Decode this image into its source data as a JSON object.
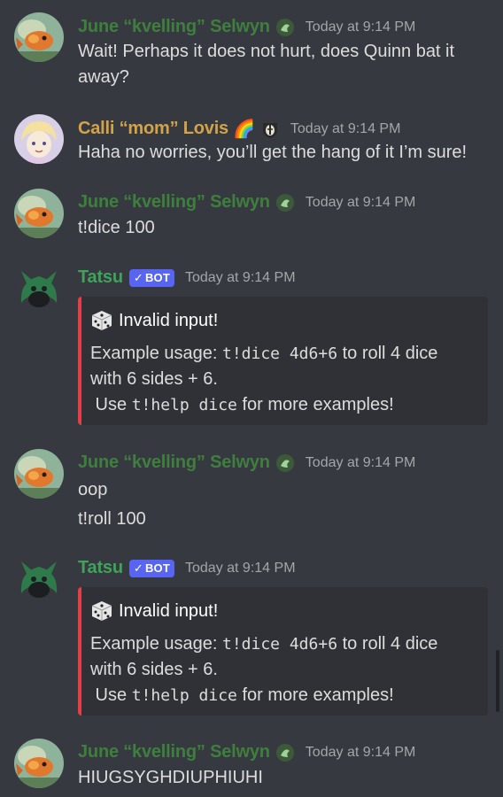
{
  "colors": {
    "background": "#36393f",
    "june_name": "#3f7f3e",
    "calli_name": "#d3a34a",
    "tatsu_name": "#3fa35b",
    "bot_tag": "#5865f2",
    "embed_border": "#e0404a",
    "embed_bg": "#2f3136",
    "timestamp": "#a3a6aa"
  },
  "messages": [
    {
      "author": "June “kvelling” Selwyn",
      "timestamp": "Today at 9:14 PM",
      "avatar_icon": "goldfish-avatar-icon",
      "role_icon": "green-badge-icon",
      "lines": [
        "Wait! Perhaps it does not hurt, does Quinn bat it",
        "away?"
      ]
    },
    {
      "author": "Calli “mom” Lovis",
      "timestamp": "Today at 9:14 PM",
      "avatar_icon": "anime-character-avatar-icon",
      "author_emoji": "🌈",
      "role_icon": "badger-badge-icon",
      "lines": [
        "Haha no worries, you’ll get the hang of it I’m sure!"
      ]
    },
    {
      "author": "June “kvelling” Selwyn",
      "timestamp": "Today at 9:14 PM",
      "avatar_icon": "goldfish-avatar-icon",
      "role_icon": "green-badge-icon",
      "lines": [
        "t!dice 100"
      ]
    },
    {
      "author": "Tatsu",
      "bot_tag": "BOT",
      "bot_check": "✓",
      "timestamp": "Today at 9:14 PM",
      "avatar_icon": "tatsu-bot-avatar-icon",
      "embed": {
        "title": "Invalid input!",
        "icon": "dice-icon",
        "line1_prefix": "Example usage: ",
        "line1_code": "t!dice 4d6+6",
        "line1_suffix": " to roll 4 dice",
        "line2": "with 6 sides + 6.",
        "line3_prefix": " Use ",
        "line3_code": "t!help dice",
        "line3_suffix": " for more examples!"
      }
    },
    {
      "author": "June “kvelling” Selwyn",
      "timestamp": "Today at 9:14 PM",
      "avatar_icon": "goldfish-avatar-icon",
      "role_icon": "green-badge-icon",
      "lines": [
        "oop",
        "t!roll 100"
      ]
    },
    {
      "author": "Tatsu",
      "bot_tag": "BOT",
      "bot_check": "✓",
      "timestamp": "Today at 9:14 PM",
      "avatar_icon": "tatsu-bot-avatar-icon",
      "embed": {
        "title": "Invalid input!",
        "icon": "dice-icon",
        "line1_prefix": "Example usage: ",
        "line1_code": "t!dice 4d6+6",
        "line1_suffix": " to roll 4 dice",
        "line2": "with 6 sides + 6.",
        "line3_prefix": " Use ",
        "line3_code": "t!help dice",
        "line3_suffix": " for more examples!"
      }
    },
    {
      "author": "June “kvelling” Selwyn",
      "timestamp": "Today at 9:14 PM",
      "avatar_icon": "goldfish-avatar-icon",
      "role_icon": "green-badge-icon",
      "lines": [
        "HIUGSYGHDIUPHIUHI"
      ]
    }
  ]
}
